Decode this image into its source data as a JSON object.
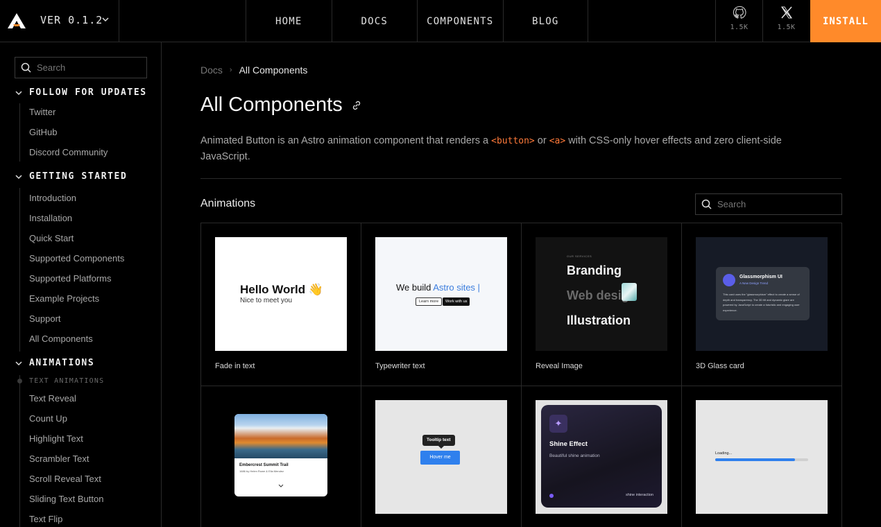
{
  "header": {
    "version": "VER 0.1.2",
    "nav": [
      "HOME",
      "DOCS",
      "COMPONENTS",
      "BLOG"
    ],
    "github_count": "1.5K",
    "x_count": "1.5K",
    "install_label": "INSTALL"
  },
  "sidebar": {
    "search_placeholder": "Search",
    "follow": {
      "title": "FOLLOW FOR UPDATES",
      "items": [
        "Twitter",
        "GitHub",
        "Discord Community"
      ]
    },
    "getting_started": {
      "title": "GETTING STARTED",
      "items": [
        "Introduction",
        "Installation",
        "Quick Start",
        "Supported Components",
        "Supported Platforms",
        "Example Projects",
        "Support",
        "All Components"
      ]
    },
    "animations": {
      "title": "ANIMATIONS",
      "sub_label": "TEXT ANIMATIONS",
      "items": [
        "Text Reveal",
        "Count Up",
        "Highlight Text",
        "Scrambler Text",
        "Scroll Reveal Text",
        "Sliding Text Button",
        "Text Flip"
      ]
    }
  },
  "main": {
    "breadcrumb": [
      "Docs",
      "All Components"
    ],
    "title": "All Components",
    "description": {
      "part1": "Animated Button is an Astro animation component that renders a ",
      "code1": "<button>",
      "part2": " or ",
      "code2": "<a>",
      "part3": " with CSS-only hover effects and zero client-side JavaScript."
    },
    "section_title": "Animations",
    "search_placeholder": "Search",
    "cards": [
      {
        "label": "Fade in text",
        "preview": {
          "title": "Hello World 👋",
          "subtitle": "Nice to meet you"
        }
      },
      {
        "label": "Typewriter text",
        "preview": {
          "text": "We build ",
          "highlight": "Astro sites",
          "btn1": "Learn more",
          "btn2": "Work with us"
        }
      },
      {
        "label": "Reveal Image",
        "preview": {
          "eyebrow": "OUR SERVICES",
          "line1": "Branding",
          "line2": "Web design",
          "line3": "Illustration"
        }
      },
      {
        "label": "3D Glass card",
        "preview": {
          "title": "Glassmorphism UI",
          "subtitle": "A New Design Trend",
          "body": "This card uses the \"glassmorphism\" effect to create a sense of depth and transparency. The 3D tilt and dynamic glare are powered by JavaScript to create a futuristic and engaging user experience."
        }
      },
      {
        "label": "",
        "preview": {
          "title": "Embercrest Summit Trail",
          "subtitle": "1686 by Helen Rowe & Elia Mendez"
        }
      },
      {
        "label": "",
        "preview": {
          "tooltip": "Tooltip text",
          "button": "Hover me"
        }
      },
      {
        "label": "",
        "preview": {
          "title": "Shine Effect",
          "subtitle": "Beautiful shine animation",
          "footer": "shine interaction"
        }
      },
      {
        "label": "",
        "preview": {
          "text": "Loading...",
          "progress": 0.86
        }
      }
    ]
  },
  "colors": {
    "accent": "#ff8a2a",
    "code": "#ff7a3a",
    "link_blue": "#3b7ddd"
  }
}
